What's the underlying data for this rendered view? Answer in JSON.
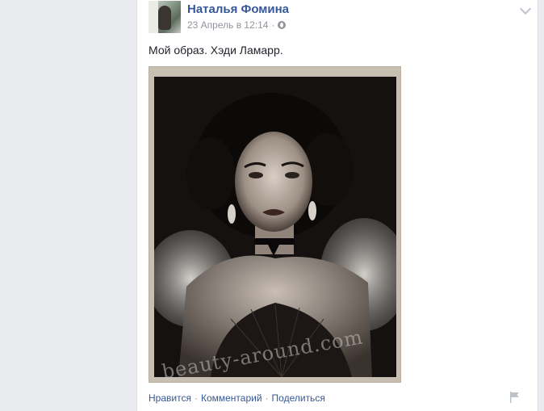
{
  "post": {
    "author": "Наталья Фомина",
    "timestamp": "23 Апрель в 12:14",
    "meta_separator": "·",
    "text": "Мой образ. Хэди Ламарр.",
    "photo_watermark": "beauty-around.com"
  },
  "actions": {
    "like": "Нравится",
    "comment": "Комментарий",
    "share": "Поделиться",
    "separator": "·"
  },
  "icons": {
    "privacy": "globe-icon",
    "menu": "chevron-down-icon",
    "report": "flag-icon"
  },
  "colors": {
    "link": "#365899",
    "meta": "#90949c",
    "background": "#e9ebee"
  }
}
